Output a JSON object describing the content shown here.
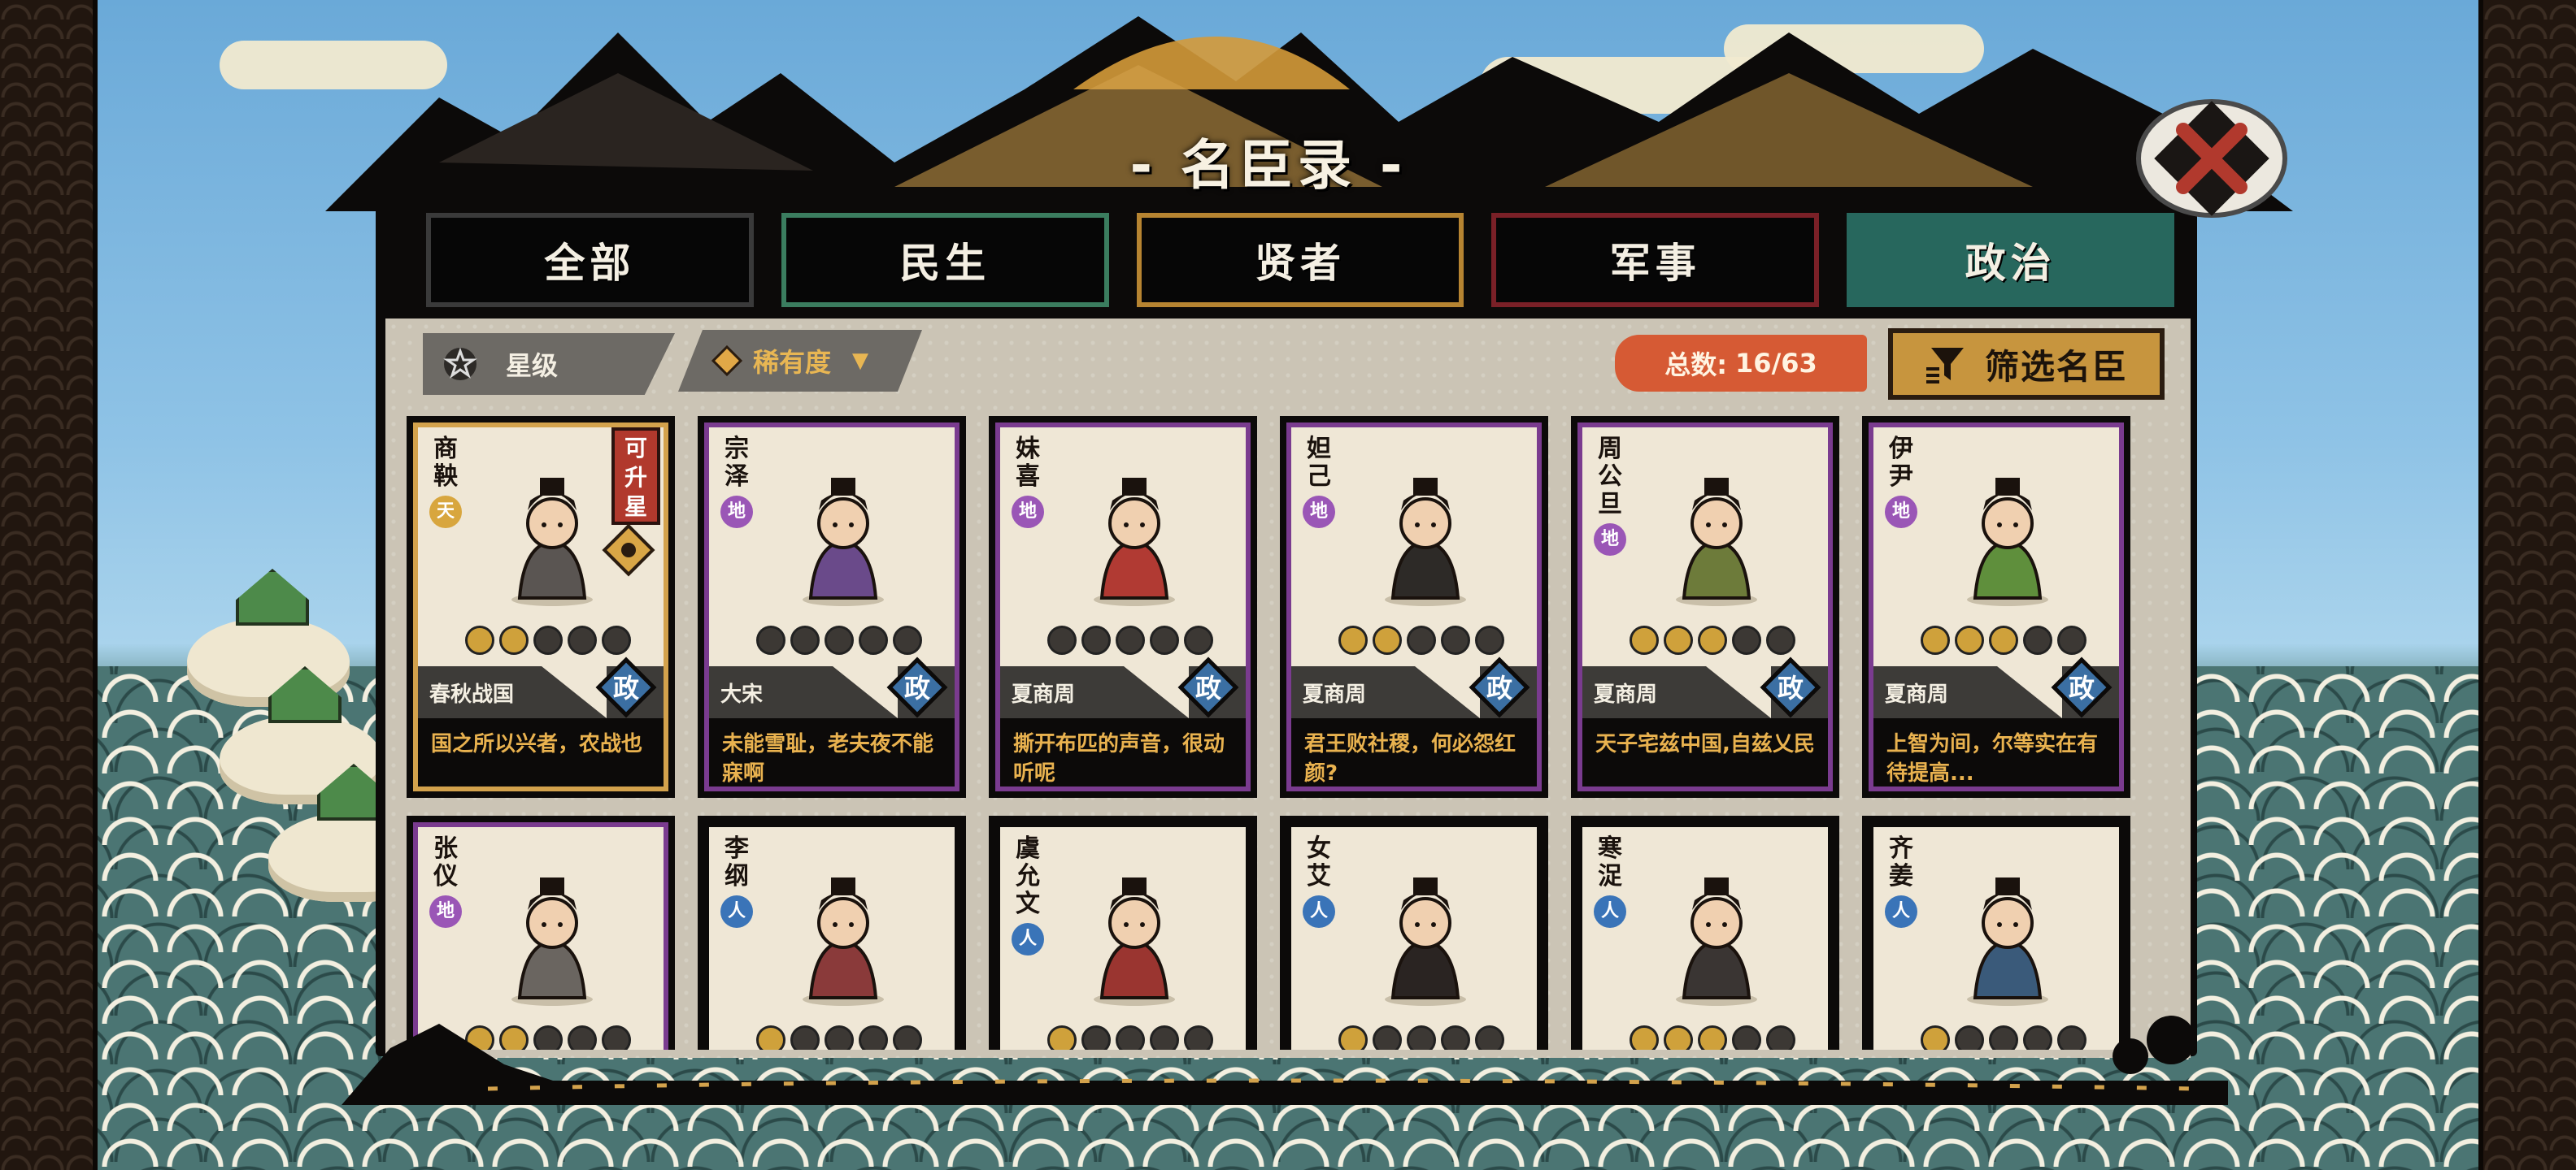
{
  "title": "- 名臣录 -",
  "tabs": [
    {
      "label": "全部"
    },
    {
      "label": "民生"
    },
    {
      "label": "贤者"
    },
    {
      "label": "军事"
    },
    {
      "label": "政治"
    }
  ],
  "filters": {
    "star_label": "星级",
    "rarity_label": "稀有度"
  },
  "total": {
    "label": "总数:",
    "value": "16/63"
  },
  "screen_button": "筛选名臣",
  "cards": [
    {
      "name": "商鞅",
      "rank": "天",
      "era": "春秋战国",
      "quote": "国之所以兴者，农战也",
      "stars": 2,
      "type": "政",
      "upgrade": "可升星"
    },
    {
      "name": "宗泽",
      "rank": "地",
      "era": "大宋",
      "quote": "未能雪耻，老夫夜不能寐啊",
      "stars": 0,
      "type": "政"
    },
    {
      "name": "妹喜",
      "rank": "地",
      "era": "夏商周",
      "quote": "撕开布匹的声音，很动听呢",
      "stars": 0,
      "type": "政"
    },
    {
      "name": "妲己",
      "rank": "地",
      "era": "夏商周",
      "quote": "君王败社稷，何必怨红颜?",
      "stars": 2,
      "type": "政"
    },
    {
      "name": "周公旦",
      "rank": "地",
      "era": "夏商周",
      "quote": "天子宅兹中国,自兹乂民",
      "stars": 3,
      "type": "政"
    },
    {
      "name": "伊尹",
      "rank": "地",
      "era": "夏商周",
      "quote": "上智为间，尔等实在有待提高...",
      "stars": 3,
      "type": "政"
    },
    {
      "name": "张仪",
      "rank": "地",
      "stars": 2
    },
    {
      "name": "李纲",
      "rank": "人",
      "stars": 1
    },
    {
      "name": "虞允文",
      "rank": "人",
      "stars": 1
    },
    {
      "name": "女艾",
      "rank": "人",
      "stars": 1
    },
    {
      "name": "寒浞",
      "rank": "人",
      "stars": 3
    },
    {
      "name": "齐姜",
      "rank": "人",
      "stars": 1
    }
  ],
  "colors": {
    "politics_tab": "#27675d",
    "people_tab_border": "#3b7d5f",
    "sage_tab_border": "#b68431",
    "military_tab_border": "#7a2027",
    "quote_text": "#e9b24f",
    "total_badge": "#d65a34",
    "screen_button": "#c7953e"
  },
  "icons": {
    "close": "close-x-icon",
    "star_filter": "flower-star-icon",
    "rarity_filter": "diamond-icon",
    "screen": "funnel-icon",
    "type": "politics-diamond-badge"
  }
}
